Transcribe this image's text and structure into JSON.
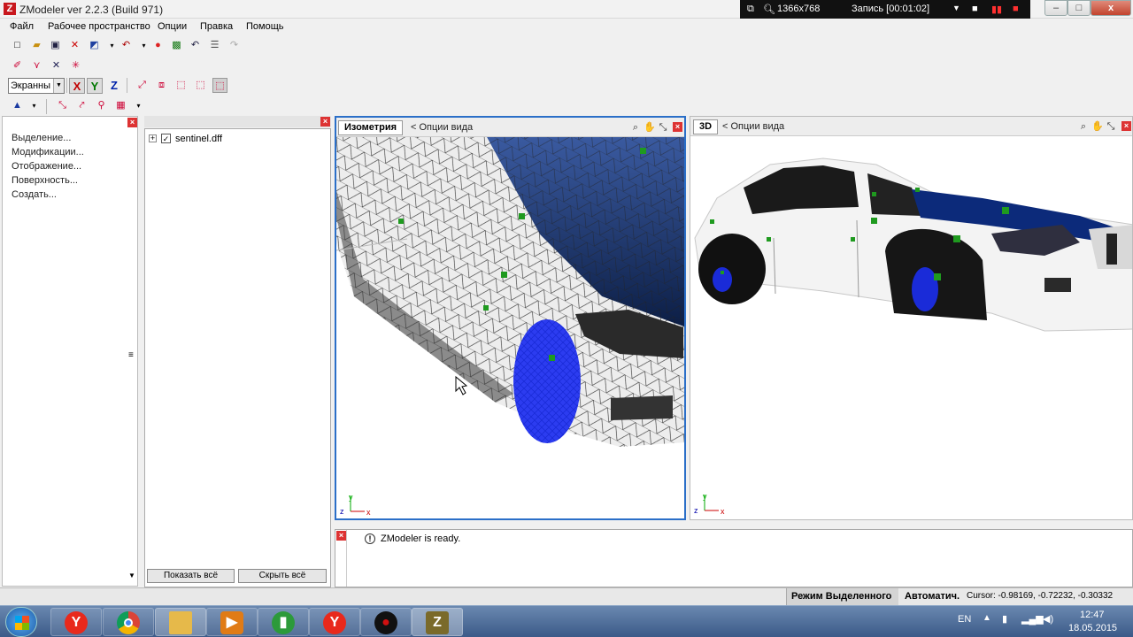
{
  "window": {
    "title": "ZModeler ver 2.2.3 (Build 971)",
    "app_icon_letter": "Z"
  },
  "recorder": {
    "resolution": "1366x768",
    "status": "Запись [00:01:02]"
  },
  "window_buttons": {
    "minimize": "–",
    "maximize": "□",
    "close": "x"
  },
  "menu": {
    "items": [
      "Файл",
      "Рабочее пространство",
      "Опции",
      "Правка",
      "Помощь"
    ]
  },
  "toolbar3": {
    "view_mode": "Экранны",
    "axes": [
      {
        "label": "X",
        "color": "#c00000"
      },
      {
        "label": "Y",
        "color": "#007700"
      },
      {
        "label": "Z",
        "color": "#0022aa"
      }
    ]
  },
  "left_panel": {
    "items": [
      "Выделение...",
      "Модификации...",
      "Отображение...",
      "Поверхность...",
      "Создать..."
    ]
  },
  "tree": {
    "expand_symbol": "+",
    "checkbox": "✓",
    "root_item": "sentinel.dff",
    "show_all_button": "Показать всё",
    "hide_all_button": "Скрыть всё"
  },
  "viewport_iso": {
    "tab": "Изометрия",
    "options": "<  Опции вида",
    "axis_labels": {
      "y": "y",
      "z": "z",
      "x": "x"
    }
  },
  "viewport_3d": {
    "tab": "3D",
    "options": "<  Опции вида",
    "axis_labels": {
      "y": "y",
      "z": "z",
      "x": "x"
    }
  },
  "console": {
    "message": "ZModeler is ready.",
    "info_symbol": "!"
  },
  "status": {
    "mode": "Режим Выделенного",
    "auto": "Автоматич.",
    "cursor": "Cursor: -0.98169, -0.72232, -0.30332"
  },
  "taskbar": {
    "language": "EN",
    "time": "12:47",
    "date": "18.05.2015",
    "apps": [
      {
        "name": "yandex-browser",
        "glyph": "Y",
        "color": "#e8291c"
      },
      {
        "name": "chrome",
        "glyph": "",
        "color": "#2a9d3b"
      },
      {
        "name": "explorer",
        "glyph": "",
        "color": "#e6b94a"
      },
      {
        "name": "media-player",
        "glyph": "▶",
        "color": "#e07b16"
      },
      {
        "name": "signal-app",
        "glyph": "▮",
        "color": "#2c9a3a"
      },
      {
        "name": "yandex",
        "glyph": "Y",
        "color": "#e8291c"
      },
      {
        "name": "recorder",
        "glyph": "●",
        "color": "#d01010"
      },
      {
        "name": "zmodeler",
        "glyph": "Z",
        "color": "#7a6a2a"
      }
    ]
  },
  "colors": {
    "accent": "#2b6fc8",
    "wire_blue": "#1a2bd8",
    "selection_green": "#1f9a1f",
    "close_red": "#d33333"
  }
}
